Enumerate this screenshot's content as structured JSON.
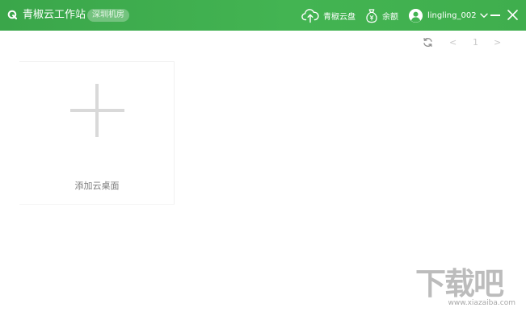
{
  "titlebar": {
    "app_title": "青椒云工作站",
    "region_badge": "深圳机房",
    "cloud_disk_label": "青椒云盘",
    "balance_label": "余额",
    "username": "lingling_002",
    "icons": {
      "logo": "q-logo-icon",
      "cloud": "cloud-upload-icon",
      "balance": "money-bag-icon",
      "avatar": "user-avatar-icon",
      "dropdown": "chevron-down-icon",
      "minimize": "minimize-icon",
      "close": "close-icon"
    },
    "colors": {
      "bar_start": "#3aa64a",
      "bar_end": "#43b452",
      "text": "#ffffff"
    }
  },
  "toolbar": {
    "refresh_icon": "refresh-icon",
    "pager": {
      "prev": "<",
      "current_page": "1",
      "next": ">"
    }
  },
  "desktops": {
    "add_card_label": "添加云桌面",
    "add_icon": "plus-icon"
  },
  "watermark": {
    "main_text": "下载吧",
    "sub_text": "www.xiazaiba.com"
  }
}
